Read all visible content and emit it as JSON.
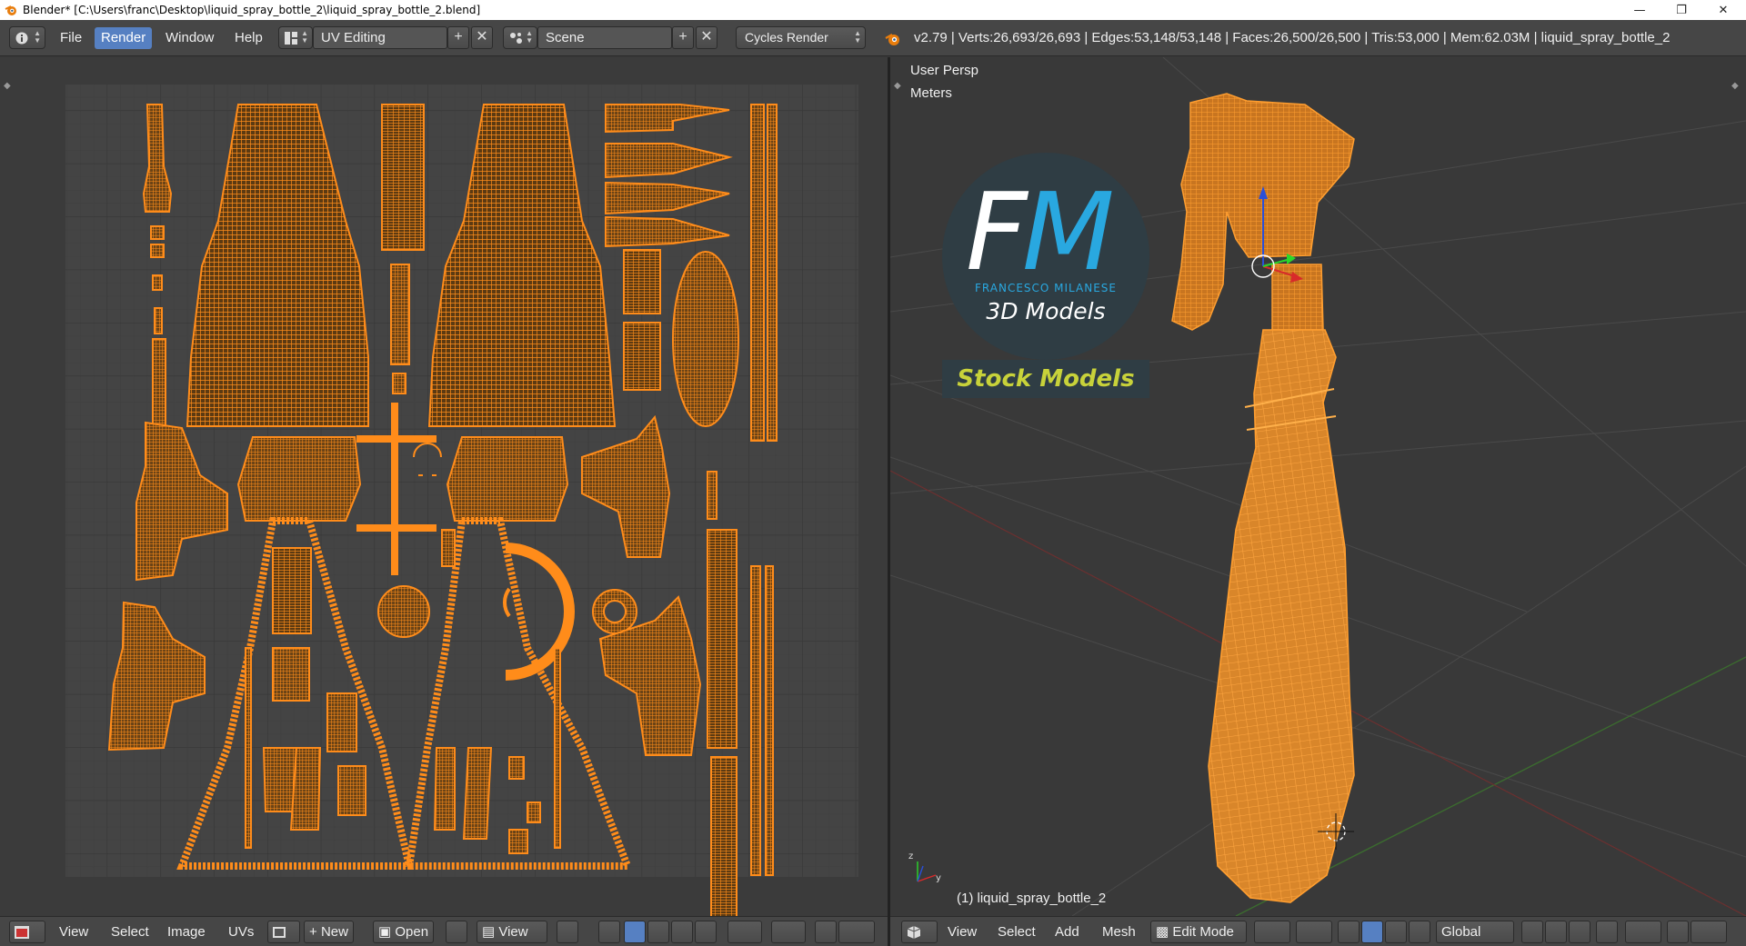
{
  "window": {
    "title": "Blender* [C:\\Users\\franc\\Desktop\\liquid_spray_bottle_2\\liquid_spray_bottle_2.blend]",
    "minimize": "—",
    "maximize": "❐",
    "close": "✕"
  },
  "info_header": {
    "menus": [
      "File",
      "Render",
      "Window",
      "Help"
    ],
    "active_menu": "Render",
    "screen_layout": "UV Editing",
    "scene": "Scene",
    "render_engine": "Cycles Render",
    "stats": "v2.79 | Verts:26,693/26,693 | Edges:53,148/53,148 | Faces:26,500/26,500 | Tris:53,000 | Mem:62.03M | liquid_spray_bottle_2"
  },
  "uv_editor": {
    "header": {
      "view": "View",
      "select": "Select",
      "image": "Image",
      "uvs": "UVs",
      "new": "New",
      "open": "Open",
      "view_dropdown": "View"
    }
  },
  "viewport": {
    "view_label": "User Persp",
    "units_label": "Meters",
    "object_label": "(1) liquid_spray_bottle_2",
    "logo": {
      "f": "F",
      "m": "M",
      "name": "FRANCESCO MILANESE",
      "subtitle": "3D Models",
      "stock": "Stock Models"
    },
    "header": {
      "view": "View",
      "select": "Select",
      "add": "Add",
      "mesh": "Mesh",
      "mode": "Edit Mode",
      "orientation": "Global"
    }
  },
  "colors": {
    "accent": "#5680c2",
    "uv_orange": "#ff8c1a",
    "mesh_dark": "#5c3a12",
    "logo_blue": "#29a8e0",
    "logo_green": "#c8d23a"
  }
}
